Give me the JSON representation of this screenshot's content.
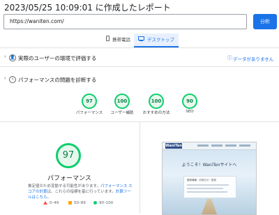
{
  "header": {
    "title": "2023/05/25 10:09:01 に作成したレポート"
  },
  "search": {
    "url_value": "https://waniten.com/",
    "analyze_label": "分析"
  },
  "tabs": [
    {
      "label": "携帯電話",
      "icon": "phone-icon",
      "selected": false
    },
    {
      "label": "デスクトップ",
      "icon": "desktop-icon",
      "selected": true
    }
  ],
  "field_data": {
    "title": "実際のユーザーの環境で評価する",
    "no_data_label": "データがありません"
  },
  "diagnose": {
    "title": "パフォーマンスの問題を診断する",
    "gauges": [
      {
        "score": "97",
        "label": "パフォーマンス"
      },
      {
        "score": "100",
        "label": "ユーザー補助"
      },
      {
        "score": "100",
        "label": "おすすめの方法"
      },
      {
        "score": "90",
        "label": "SEO"
      }
    ]
  },
  "performance": {
    "score": "97",
    "label": "パフォーマンス",
    "desc_prefix": "推定値のため変動する可能性があります。",
    "desc_link1": "パフォーマンス スコアの計算",
    "desc_middle": "は、これらの指標を基に行っています。",
    "desc_link2": "計算ツールはこちら",
    "desc_suffix": "。"
  },
  "legend": [
    {
      "range": "0–49",
      "color": "#ff4e42"
    },
    {
      "range": "50–89",
      "color": "#ffa400"
    },
    {
      "range": "90–100",
      "color": "#0cce6b"
    }
  ],
  "screenshot": {
    "logo_text": "WaniTen",
    "hero_title": "ようこそ！WaniTenサイトへ",
    "card_text": "更新情報・お知らせ・告知"
  },
  "colors": {
    "accent": "#1a73e8",
    "good": "#0cce6b",
    "average": "#ffa400",
    "poor": "#ff4e42"
  }
}
